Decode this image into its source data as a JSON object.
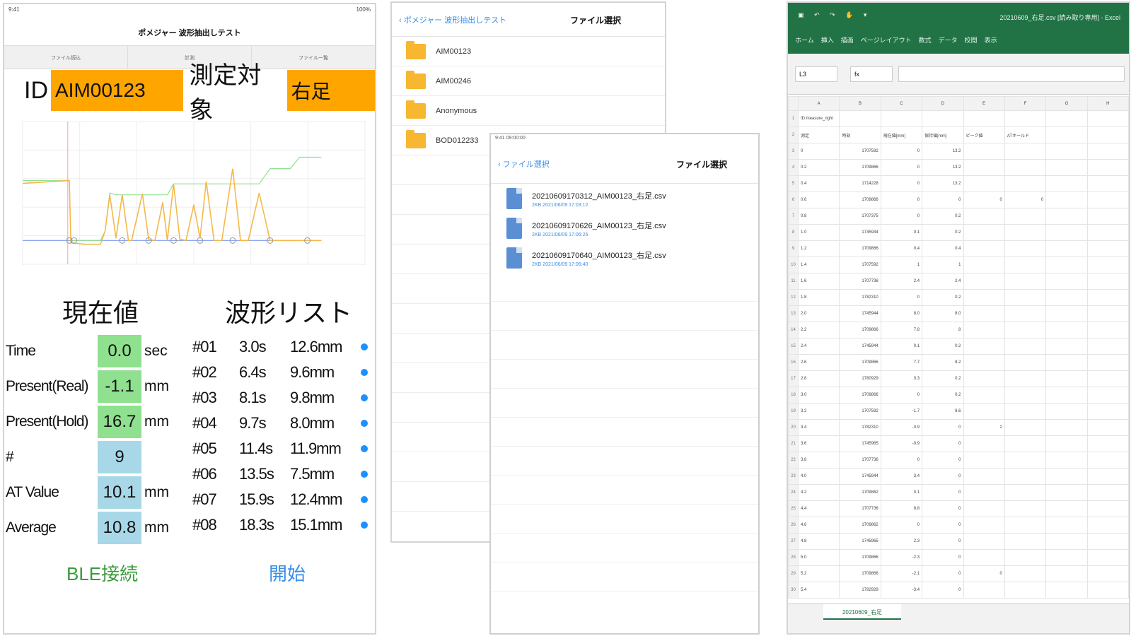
{
  "app": {
    "title": "ポメジャー 波形抽出しテスト",
    "tabs": [
      "ファイル読込",
      "計測",
      "ファイル一覧"
    ],
    "id_label": "ID",
    "id_value": "AIM00123",
    "target_label": "測定対象",
    "target_value": "右足",
    "current_heading": "現在値",
    "wave_heading": "波形リスト",
    "current_values": [
      {
        "name": "Time",
        "value": "0.0",
        "unit": "sec",
        "color": "green"
      },
      {
        "name": "Present(Real)",
        "value": "-1.1",
        "unit": "mm",
        "color": "green"
      },
      {
        "name": "Present(Hold)",
        "value": "16.7",
        "unit": "mm",
        "color": "green"
      },
      {
        "name": "#",
        "value": "9",
        "unit": "",
        "color": "blue"
      },
      {
        "name": "AT Value",
        "value": "10.1",
        "unit": "mm",
        "color": "blue"
      },
      {
        "name": "Average",
        "value": "10.8",
        "unit": "mm",
        "color": "blue"
      }
    ],
    "waves": [
      {
        "no": "#01",
        "time": "3.0s",
        "mm": "12.6mm"
      },
      {
        "no": "#02",
        "time": "6.4s",
        "mm": "9.6mm"
      },
      {
        "no": "#03",
        "time": "8.1s",
        "mm": "9.8mm"
      },
      {
        "no": "#04",
        "time": "9.7s",
        "mm": "8.0mm"
      },
      {
        "no": "#05",
        "time": "11.4s",
        "mm": "11.9mm"
      },
      {
        "no": "#06",
        "time": "13.5s",
        "mm": "7.5mm"
      },
      {
        "no": "#07",
        "time": "15.9s",
        "mm": "12.4mm"
      },
      {
        "no": "#08",
        "time": "18.3s",
        "mm": "15.1mm"
      }
    ],
    "ble_button": "BLE接続",
    "start_button": "開始"
  },
  "chart_data": {
    "type": "line",
    "x": [
      0,
      2,
      3,
      3.1,
      4,
      5,
      5.3,
      5.6,
      6,
      6.4,
      6.8,
      7,
      7.7,
      8.1,
      8.5,
      9,
      9.3,
      9.7,
      10.1,
      10.5,
      11,
      11.4,
      11.8,
      12.3,
      12.8,
      13.5,
      14,
      14.5,
      15.2,
      15.9,
      16.6,
      17.2,
      17.8,
      18.3,
      18.8,
      19.2
    ],
    "series": [
      {
        "values": [
          0,
          0,
          0,
          0,
          0,
          0,
          0,
          0,
          0,
          0,
          0,
          0,
          0,
          0,
          0,
          0,
          0,
          0,
          0,
          0,
          0,
          0,
          0,
          0,
          0,
          0,
          0,
          0,
          0,
          0,
          0,
          0,
          0,
          0,
          0,
          0
        ],
        "color": "#7b9cf0"
      },
      {
        "values": [
          12.6,
          12.6,
          12.6,
          0,
          0,
          0,
          2,
          10,
          9.6,
          9.6,
          9.6,
          9.6,
          9.6,
          9.6,
          9.6,
          9.6,
          9.6,
          11.9,
          11.9,
          11.9,
          11.9,
          11.9,
          11.9,
          11.9,
          11.9,
          11.9,
          11.9,
          11.9,
          11.9,
          15.1,
          15.1,
          15.1,
          17.5,
          17.5,
          17.5,
          17.5
        ],
        "color": "#90e090"
      },
      {
        "values": [
          12,
          12.4,
          12.6,
          -0.5,
          -0.8,
          -0.8,
          2,
          9.6,
          0.5,
          9.6,
          0,
          0,
          9.8,
          0.2,
          0,
          8.0,
          0,
          11.9,
          0.3,
          0,
          7.5,
          0.5,
          12.4,
          0,
          0,
          15.1,
          0,
          0,
          10,
          0,
          0,
          0,
          0,
          0,
          0,
          0
        ],
        "color": "#f3b94a"
      }
    ],
    "xlim": [
      0,
      22
    ],
    "ylim": [
      -5,
      25
    ]
  },
  "files": {
    "back_label": "ポメジャー 波形抽出しテスト",
    "title": "ファイル選択",
    "folders": [
      "AIM00123",
      "AIM00246",
      "Anonymous",
      "BOD012233"
    ]
  },
  "filelist": {
    "status": "9:41 09:00:00",
    "back_label": "ファイル選択",
    "title": "ファイル選択",
    "items": [
      {
        "name": "20210609170312_AIM00123_右足.csv",
        "meta": "2KB 2021/06/09 17:03:12"
      },
      {
        "name": "20210609170626_AIM00123_右足.csv",
        "meta": "2KB 2021/06/09 17:06:26"
      },
      {
        "name": "20210609170640_AIM00123_右足.csv",
        "meta": "2KB 2021/06/09 17:06:40"
      }
    ]
  },
  "excel": {
    "filename": "20210609_右足.csv [読み取り専用] - Excel",
    "ribbon_tabs": [
      "ホーム",
      "挿入",
      "描画",
      "ページレイアウト",
      "数式",
      "データ",
      "校閲",
      "表示"
    ],
    "name_box": "L3",
    "fx": "fx",
    "columns": [
      "A",
      "B",
      "C",
      "D",
      "E",
      "F",
      "G",
      "H"
    ],
    "rows": [
      [
        "ID:measure_right",
        "",
        "",
        "",
        "",
        "",
        "",
        ""
      ],
      [
        "測定",
        "時刻",
        "現在値[mm]",
        "保持値[mm]",
        "ピーク値",
        "ATホールド",
        "",
        ""
      ],
      [
        "0",
        "1707592",
        "0",
        "13.2",
        "",
        "",
        "",
        ""
      ],
      [
        "0.2",
        "1709866",
        "0",
        "13.2",
        "",
        "",
        "",
        ""
      ],
      [
        "0.4",
        "1714228",
        "0",
        "13.2",
        "",
        "",
        "",
        ""
      ],
      [
        "0.6",
        "1709866",
        "0",
        "0",
        "0",
        "0",
        "",
        ""
      ],
      [
        "0.8",
        "1707375",
        "0",
        "0.2",
        "",
        "",
        "",
        ""
      ],
      [
        "1.0",
        "1745944",
        "0.1",
        "0.2",
        "",
        "",
        "",
        ""
      ],
      [
        "1.2",
        "1709866",
        "0.4",
        "0.4",
        "",
        "",
        "",
        ""
      ],
      [
        "1.4",
        "1707592",
        "1",
        "1",
        "",
        "",
        "",
        ""
      ],
      [
        "1.6",
        "1707736",
        "2.4",
        "2.4",
        "",
        "",
        "",
        ""
      ],
      [
        "1.8",
        "1782310",
        "0",
        "0.2",
        "",
        "",
        "",
        ""
      ],
      [
        "2.0",
        "1745944",
        "8.0",
        "8.0",
        "",
        "",
        "",
        ""
      ],
      [
        "2.2",
        "1709866",
        "7.8",
        "8",
        "",
        "",
        "",
        ""
      ],
      [
        "2.4",
        "1745944",
        "0.1",
        "0.2",
        "",
        "",
        "",
        ""
      ],
      [
        "2.6",
        "1709866",
        "7.7",
        "8.2",
        "",
        "",
        "",
        ""
      ],
      [
        "2.8",
        "1780929",
        "0.3",
        "0.2",
        "",
        "",
        "",
        ""
      ],
      [
        "3.0",
        "1709866",
        "0",
        "0.2",
        "",
        "",
        "",
        ""
      ],
      [
        "3.2",
        "1707592",
        "-1.7",
        "8.6",
        "",
        "",
        "",
        ""
      ],
      [
        "3.4",
        "1782310",
        "-0.9",
        "0",
        "2",
        "",
        "",
        ""
      ],
      [
        "3.6",
        "1745965",
        "-0.9",
        "0",
        "",
        "",
        "",
        ""
      ],
      [
        "3.8",
        "1707736",
        "0",
        "0",
        "",
        "",
        "",
        ""
      ],
      [
        "4.0",
        "1745944",
        "3.4",
        "0",
        "",
        "",
        "",
        ""
      ],
      [
        "4.2",
        "1709862",
        "0.1",
        "0",
        "",
        "",
        "",
        ""
      ],
      [
        "4.4",
        "1707736",
        "8.8",
        "0",
        "",
        "",
        "",
        ""
      ],
      [
        "4.6",
        "1709862",
        "0",
        "0",
        "",
        "",
        "",
        ""
      ],
      [
        "4.8",
        "1745965",
        "2.3",
        "0",
        "",
        "",
        "",
        ""
      ],
      [
        "5.0",
        "1709866",
        "-2.3",
        "0",
        "",
        "",
        "",
        ""
      ],
      [
        "5.2",
        "1709866",
        "-2.1",
        "0",
        "0",
        "",
        "",
        ""
      ],
      [
        "5.4",
        "1782929",
        "-3.4",
        "0",
        "",
        "",
        "",
        ""
      ]
    ],
    "sheet_tab": "20210609_右足"
  }
}
